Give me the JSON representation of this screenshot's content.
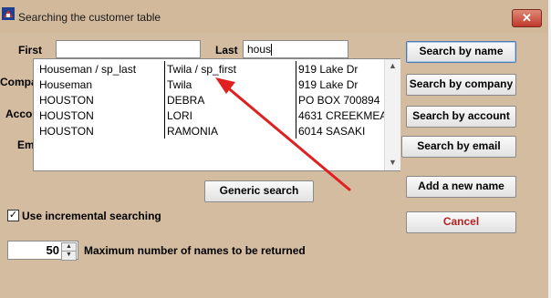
{
  "window": {
    "title": "Searching the customer table",
    "close_glyph": "✕"
  },
  "labels": {
    "first": "First",
    "last": "Last",
    "company_partial": "Compa",
    "account_partial": "Accou",
    "email_partial": "Em"
  },
  "fields": {
    "first_value": "",
    "last_value": "hous"
  },
  "results": [
    {
      "last": "Houseman / sp_last",
      "first": "Twila / sp_first",
      "address": "919 Lake Dr"
    },
    {
      "last": "Houseman",
      "first": "Twila",
      "address": "919 Lake Dr"
    },
    {
      "last": "HOUSTON",
      "first": "DEBRA",
      "address": "PO BOX 700894"
    },
    {
      "last": "HOUSTON",
      "first": "LORI",
      "address": "4631 CREEKMEA"
    },
    {
      "last": "HOUSTON",
      "first": "RAMONIA",
      "address": "6014 SASAKI"
    }
  ],
  "buttons": {
    "search_name": "Search by name",
    "search_company": "Search by company",
    "search_account": "Search by account",
    "search_email": "Search by email",
    "add_new": "Add a new name",
    "cancel": "Cancel",
    "generic": "Generic search"
  },
  "options": {
    "incremental_label": "Use incremental searching",
    "incremental_checked": true,
    "max_names_value": "50",
    "max_names_label": "Maximum number of names to be returned"
  },
  "colors": {
    "window_bg": "#d4bca0",
    "annotation_arrow": "#e02020",
    "close_button": "#c0392b"
  },
  "icons": {
    "app": "app-icon",
    "close": "close-icon",
    "scroll_up": "scroll-up-icon",
    "scroll_down": "scroll-down-icon",
    "spin_up": "spin-up-icon",
    "spin_down": "spin-down-icon",
    "checkbox": "checkmark-icon"
  }
}
